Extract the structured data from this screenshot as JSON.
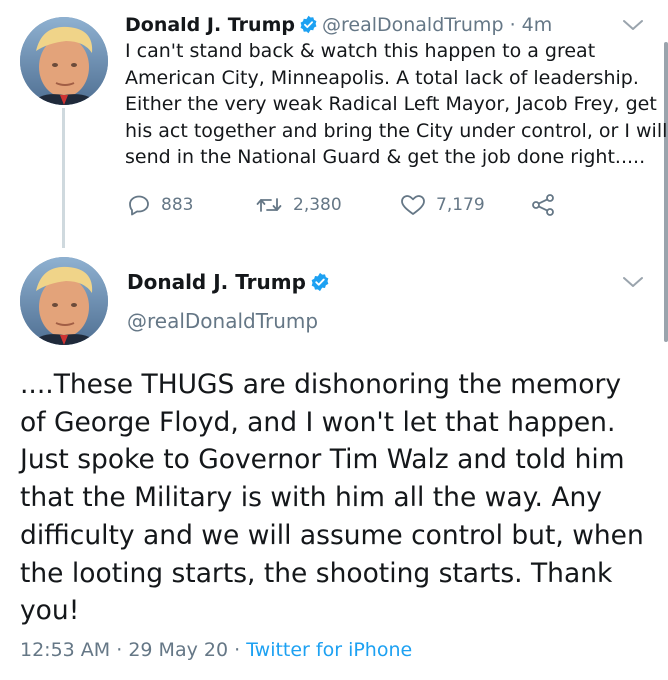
{
  "colors": {
    "text": "#14171a",
    "muted": "#657786",
    "link": "#1da1f2",
    "verified": "#1da1f2",
    "thread_line": "#cfd9de"
  },
  "tweet_reply": {
    "author_name": "Donald J. Trump",
    "handle": "@realDonaldTrump",
    "separator": "·",
    "age": "4m",
    "lines": [
      "I can't stand back & watch this happen to a great",
      "American City, Minneapolis. A total lack of leadership.",
      "Either the very weak Radical Left Mayor, Jacob Frey, get",
      "his act together and bring the City under control, or I will",
      "send in the National Guard & get the job done right....."
    ],
    "reply_count": "883",
    "retweet_count": "2,380",
    "like_count": "7,179",
    "icons": [
      "reply-icon",
      "retweet-icon",
      "like-icon",
      "share-icon",
      "chevron-down-icon",
      "verified-badge-icon"
    ]
  },
  "tweet_main": {
    "author_name": "Donald J. Trump",
    "handle": "@realDonaldTrump",
    "lines": [
      "....These THUGS are dishonoring the memory",
      "of George Floyd, and I won't let that happen.",
      "Just spoke to Governor Tim Walz and told him",
      "that the Military is with him all the way. Any",
      "difficulty and we will assume control but, when",
      "the looting starts, the shooting starts. Thank",
      "you!"
    ],
    "time": "12:53 AM",
    "separator": "·",
    "date": "29 May 20",
    "source": "Twitter for iPhone"
  }
}
